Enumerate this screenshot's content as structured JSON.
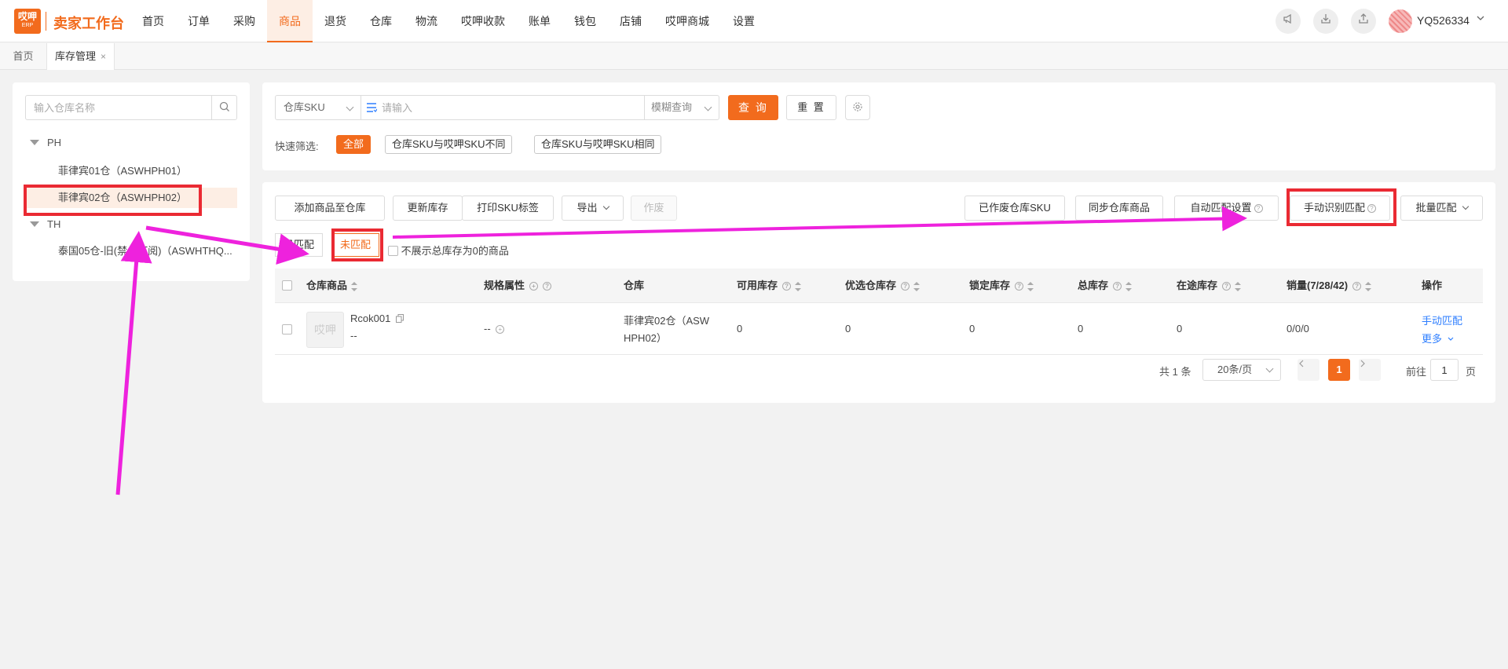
{
  "header": {
    "logo_top": "哎呷",
    "logo_bottom": "ERP",
    "app_title": "卖家工作台",
    "nav": [
      "首页",
      "订单",
      "采购",
      "商品",
      "退货",
      "仓库",
      "物流",
      "哎呷收款",
      "账单",
      "钱包",
      "店铺",
      "哎呷商城",
      "设置"
    ],
    "active_nav": "商品",
    "icons": [
      "megaphone-icon",
      "download-icon",
      "upload-icon"
    ],
    "username": "YQ526334",
    "caret": "⌄"
  },
  "tabs": {
    "home": "首页",
    "current": "库存管理",
    "close": "×"
  },
  "warehouse_panel": {
    "search_placeholder": "输入仓库名称",
    "groups": [
      {
        "name": "PH",
        "items": [
          "菲律宾01仓（ASWHPH01）",
          "菲律宾02仓（ASWHPH02）"
        ]
      },
      {
        "name": "TH",
        "items": [
          "泰国05仓-旧(禁止订阅)（ASWHTHQ..."
        ]
      }
    ],
    "selected_item": "菲律宾02仓（ASWHPH02）"
  },
  "search": {
    "field_select": "仓库SKU",
    "keyword_placeholder": "请输入",
    "mode_select": "模糊查询",
    "query_label": "查 询",
    "reset_label": "重 置",
    "quick_filter_label": "快速筛选:",
    "quick_filters": [
      "全部",
      "仓库SKU与哎呷SKU不同",
      "仓库SKU与哎呷SKU相同"
    ],
    "active_filter": "全部"
  },
  "toolbar": {
    "add_to_warehouse": "添加商品至仓库",
    "update_stock": "更新库存",
    "print_sku_label": "打印SKU标签",
    "export": "导出",
    "void": "作废",
    "voided_sku": "已作废仓库SKU",
    "sync_products": "同步仓库商品",
    "auto_match_settings": "自动匹配设置",
    "manual_match": "手动识别匹配",
    "batch_match": "批量匹配"
  },
  "match_tabs": {
    "matched": "已匹配",
    "unmatched": "未匹配",
    "active": "未匹配",
    "hide_zero_label": "不展示总库存为0的商品"
  },
  "table": {
    "columns": [
      "仓库商品",
      "规格属性",
      "仓库",
      "可用库存",
      "优选仓库存",
      "锁定库存",
      "总库存",
      "在途库存",
      "销量(7/28/42)",
      "操作"
    ],
    "rows": [
      {
        "thumb": "哎呷",
        "sku": "Rcok001",
        "sub": "--",
        "spec": "--",
        "warehouse_line1": "菲律宾02仓（ASW",
        "warehouse_line2": "HPH02）",
        "available": "0",
        "preferred": "0",
        "locked": "0",
        "total": "0",
        "in_transit": "0",
        "sales": "0/0/0",
        "action_1": "手动匹配",
        "action_2": "更多"
      }
    ]
  },
  "pagination": {
    "total": "共 1 条",
    "page_size": "20条/页",
    "current_page": "1",
    "goto_label": "前往",
    "goto_value": "1",
    "page_suffix": "页"
  },
  "colors": {
    "brand": "#f26b1d",
    "link": "#2f7fff",
    "annotation_box": "#ea2a33",
    "annotation_arrow": "#ee22dd"
  }
}
